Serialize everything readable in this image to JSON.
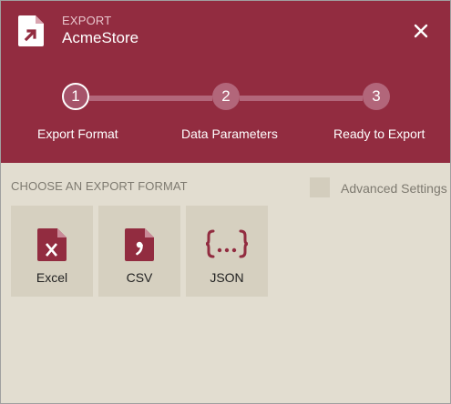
{
  "header": {
    "caption": "EXPORT",
    "title": "AcmeStore",
    "app_icon": "export-document-icon",
    "close_icon": "close-icon"
  },
  "steps": [
    {
      "number": "1",
      "label": "Export Format",
      "active": true
    },
    {
      "number": "2",
      "label": "Data Parameters",
      "active": false
    },
    {
      "number": "3",
      "label": "Ready to Export",
      "active": false
    }
  ],
  "content": {
    "section_label": "CHOOSE AN EXPORT FORMAT",
    "advanced_settings": {
      "label": "Advanced Settings",
      "checked": false
    },
    "formats": [
      {
        "label": "Excel",
        "icon": "excel-file-icon"
      },
      {
        "label": "CSV",
        "icon": "csv-file-icon"
      },
      {
        "label": "JSON",
        "icon": "json-braces-icon"
      }
    ]
  },
  "colors": {
    "header_bg": "#922c40",
    "body_bg": "#e2ddd0",
    "tile_bg": "#d6d0c0",
    "accent_icon": "#922c40"
  }
}
